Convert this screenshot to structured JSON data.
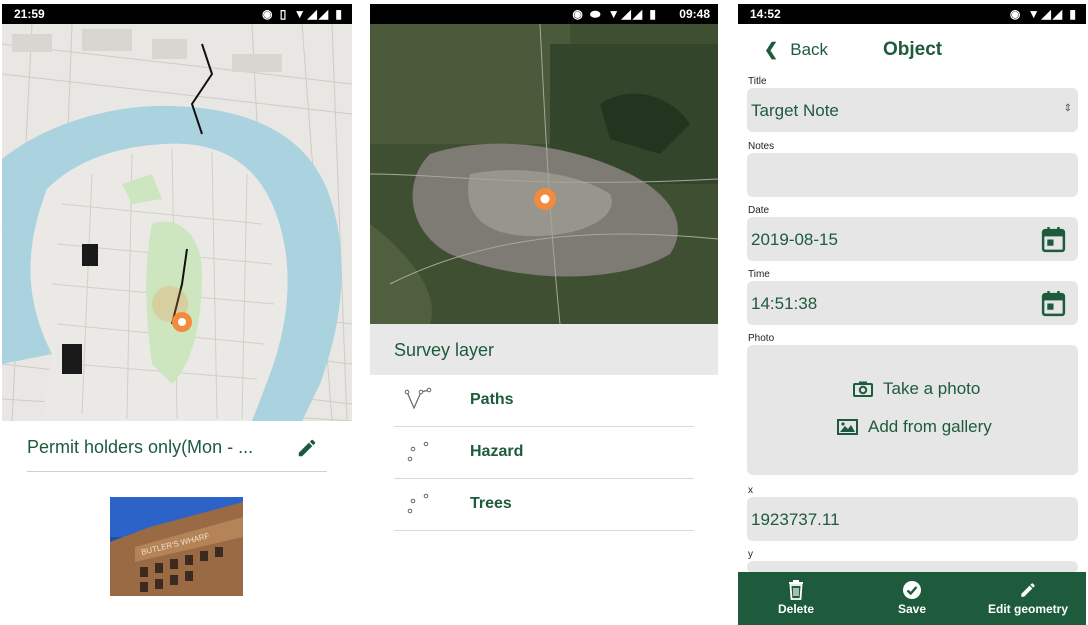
{
  "panel1": {
    "status_time": "21:59",
    "status_icons": "◉ ▯ ▼◢◢ ▮",
    "title": "Permit holders only(Mon - ...",
    "edit_icon": "pencil-icon",
    "photo_sign": "BUTLER'S WHARF"
  },
  "panel2": {
    "status_icons": "◉ ⬬ ▼◢◢ ▮",
    "status_time": "09:48",
    "layer_title": "Survey layer",
    "layers": [
      {
        "label": "Paths",
        "icon": "line-geometry-icon"
      },
      {
        "label": "Hazard",
        "icon": "points-geometry-icon"
      },
      {
        "label": "Trees",
        "icon": "points-geometry-icon"
      }
    ]
  },
  "panel3": {
    "status_time": "14:52",
    "status_icons": "◉ ▼◢◢ ▮",
    "back_label": "Back",
    "title": "Object",
    "fields": {
      "title_label": "Title",
      "title_value": "Target Note",
      "notes_label": "Notes",
      "notes_value": "",
      "date_label": "Date",
      "date_value": "2019-08-15",
      "time_label": "Time",
      "time_value": "14:51:38",
      "photo_label": "Photo",
      "x_label": "x",
      "x_value": "1923737.11",
      "y_label": "y"
    },
    "take_photo": "Take a photo",
    "add_gallery": "Add from gallery",
    "bottom": {
      "delete": "Delete",
      "save": "Save",
      "edit_geometry": "Edit geometry"
    }
  },
  "colors": {
    "brand_green": "#1d5b3c",
    "marker_orange": "#f28b3c",
    "water_blue": "#aad3df",
    "field_gray": "#e6e6e6"
  }
}
